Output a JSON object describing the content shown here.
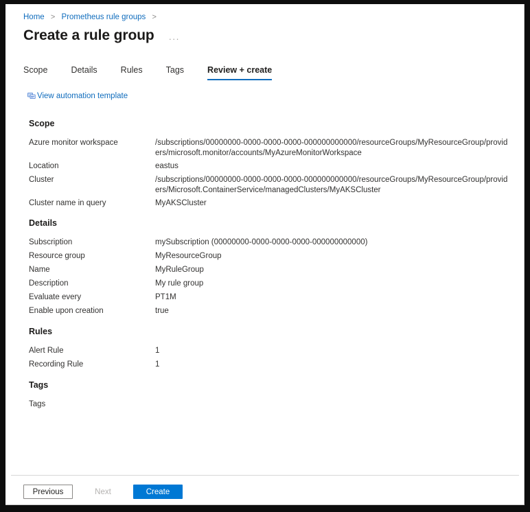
{
  "breadcrumb": {
    "items": [
      {
        "label": "Home"
      },
      {
        "label": "Prometheus rule groups"
      }
    ],
    "separator": ">"
  },
  "header": {
    "title": "Create a rule group",
    "more_menu": "···"
  },
  "tabs": [
    {
      "label": "Scope",
      "active": false
    },
    {
      "label": "Details",
      "active": false
    },
    {
      "label": "Rules",
      "active": false
    },
    {
      "label": "Tags",
      "active": false
    },
    {
      "label": "Review + create",
      "active": true
    }
  ],
  "automation_link": {
    "label": "View automation template",
    "icon": "template-icon"
  },
  "sections": [
    {
      "heading": "Scope",
      "rows": [
        {
          "label": "Azure monitor workspace",
          "value": "/subscriptions/00000000-0000-0000-0000-000000000000/resourceGroups/MyResourceGroup/providers/microsoft.monitor/accounts/MyAzureMonitorWorkspace"
        },
        {
          "label": "Location",
          "value": "eastus"
        },
        {
          "label": "Cluster",
          "value": "/subscriptions/00000000-0000-0000-0000-000000000000/resourceGroups/MyResourceGroup/providers/Microsoft.ContainerService/managedClusters/MyAKSCluster"
        },
        {
          "label": "Cluster name in query",
          "value": "MyAKSCluster"
        }
      ]
    },
    {
      "heading": "Details",
      "rows": [
        {
          "label": "Subscription",
          "value": "mySubscription (00000000-0000-0000-0000-000000000000)"
        },
        {
          "label": "Resource group",
          "value": "MyResourceGroup"
        },
        {
          "label": "Name",
          "value": "MyRuleGroup"
        },
        {
          "label": "Description",
          "value": "My rule group"
        },
        {
          "label": "Evaluate every",
          "value": "PT1M"
        },
        {
          "label": "Enable upon creation",
          "value": "true"
        }
      ]
    },
    {
      "heading": "Rules",
      "rows": [
        {
          "label": "Alert Rule",
          "value": "1"
        },
        {
          "label": "Recording Rule",
          "value": "1"
        }
      ]
    },
    {
      "heading": "Tags",
      "rows": [
        {
          "label": "Tags",
          "value": ""
        }
      ]
    }
  ],
  "footer": {
    "previous_label": "Previous",
    "next_label": "Next",
    "create_label": "Create"
  },
  "colors": {
    "accent": "#0078d4",
    "link": "#0f6cbd",
    "text": "#323130",
    "heading": "#1b1a19",
    "disabled": "#b4b2b0"
  }
}
